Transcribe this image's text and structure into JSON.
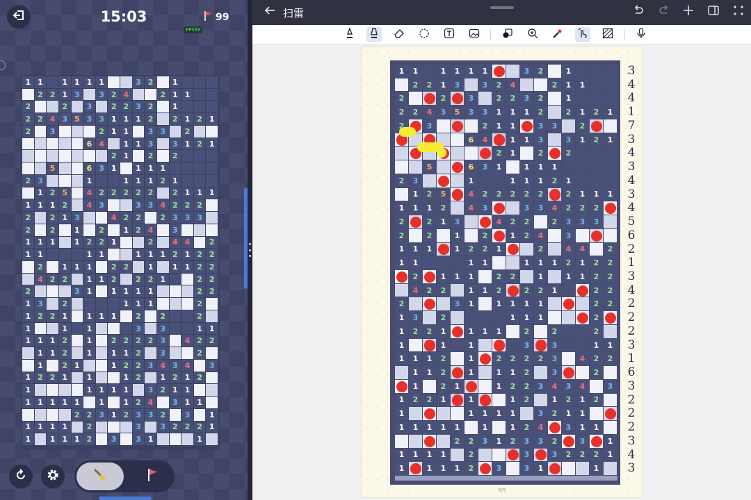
{
  "game": {
    "timer": "15:03",
    "flags_remaining": "99",
    "fps": "FPS59",
    "icons": {
      "exit": "exit-icon",
      "flag": "flag-icon",
      "restart": "restart-icon",
      "settings": "gear-icon",
      "dig": "shovel-icon"
    },
    "modes": [
      {
        "name": "dig",
        "selected": true
      },
      {
        "name": "flag",
        "selected": false
      }
    ],
    "board": {
      "cols": 16,
      "rows": 30,
      "grid": [
        "11.1111##32#1...",
        "#2213#324##211..",
        "2##2#3#2232#1...",
        "22435331112#2121",
        "2#3###211#33#2##",
        "#####64#113#3121",
        "#######21#2#2...",
        "##5##631#111....",
        "23###1..11121...",
        "#125#422222#2111",
        "1112#43##334222#",
        "2#213##422#2333#",
        "2#2#1#2#124#3###",
        "111#1221##2#44#2",
        "11...11##1112122",
        "#2#111#22#1#1122",
        "#422#112#221.#22",
        "2###31#1111###22",
        "13#2#...111###2#",
        "1221#111#2#2..2#",
        "1##1.1##.3#3..11",
        "1112#1#22223#4221",
        "#112#1#112#3##2#",
        "#1#21##1223434#3",
        "1221#1##12#1212#",
        "1####1111#3211##",
        "11111#1#124#311#",
        "####22312332#3#1",
        "1111#2###3#32221",
        "1#1112#3#31###1#"
      ]
    }
  },
  "notes": {
    "title": "扫雷",
    "page_number": "8/9",
    "icons": {
      "back": "back-arrow-icon",
      "header": [
        "undo-icon",
        "redo-icon",
        "add-page-icon",
        "sidebar-icon",
        "more-icon"
      ],
      "toolbar": [
        "pen-icon",
        "highlighter-icon",
        "eraser-icon",
        "lasso-icon",
        "text-box-icon",
        "image-icon",
        "shapes-icon",
        "zoom-icon",
        "laser-pointer-icon",
        "hand-draw-icon",
        "pattern-icon",
        "microphone-icon"
      ]
    },
    "row_counts": [
      "3",
      "4",
      "4",
      "1",
      "7",
      "3",
      "4",
      "3",
      "4",
      "3",
      "4",
      "5",
      "6",
      "2",
      "1",
      "3",
      "4",
      "2",
      "2",
      "2",
      "3",
      "1",
      "6",
      "3",
      "2",
      "2",
      "2",
      "3",
      "4",
      "3"
    ]
  },
  "colors": {
    "accent": "#4f79d8",
    "mine_dot": "#e7302a",
    "num_1": "#ffffff",
    "num_2": "#9fe0a0",
    "num_3": "#6fb8ec",
    "num_4": "#ef6f7d",
    "num_5": "#f2b15b",
    "num_6": "#f6e07b"
  }
}
